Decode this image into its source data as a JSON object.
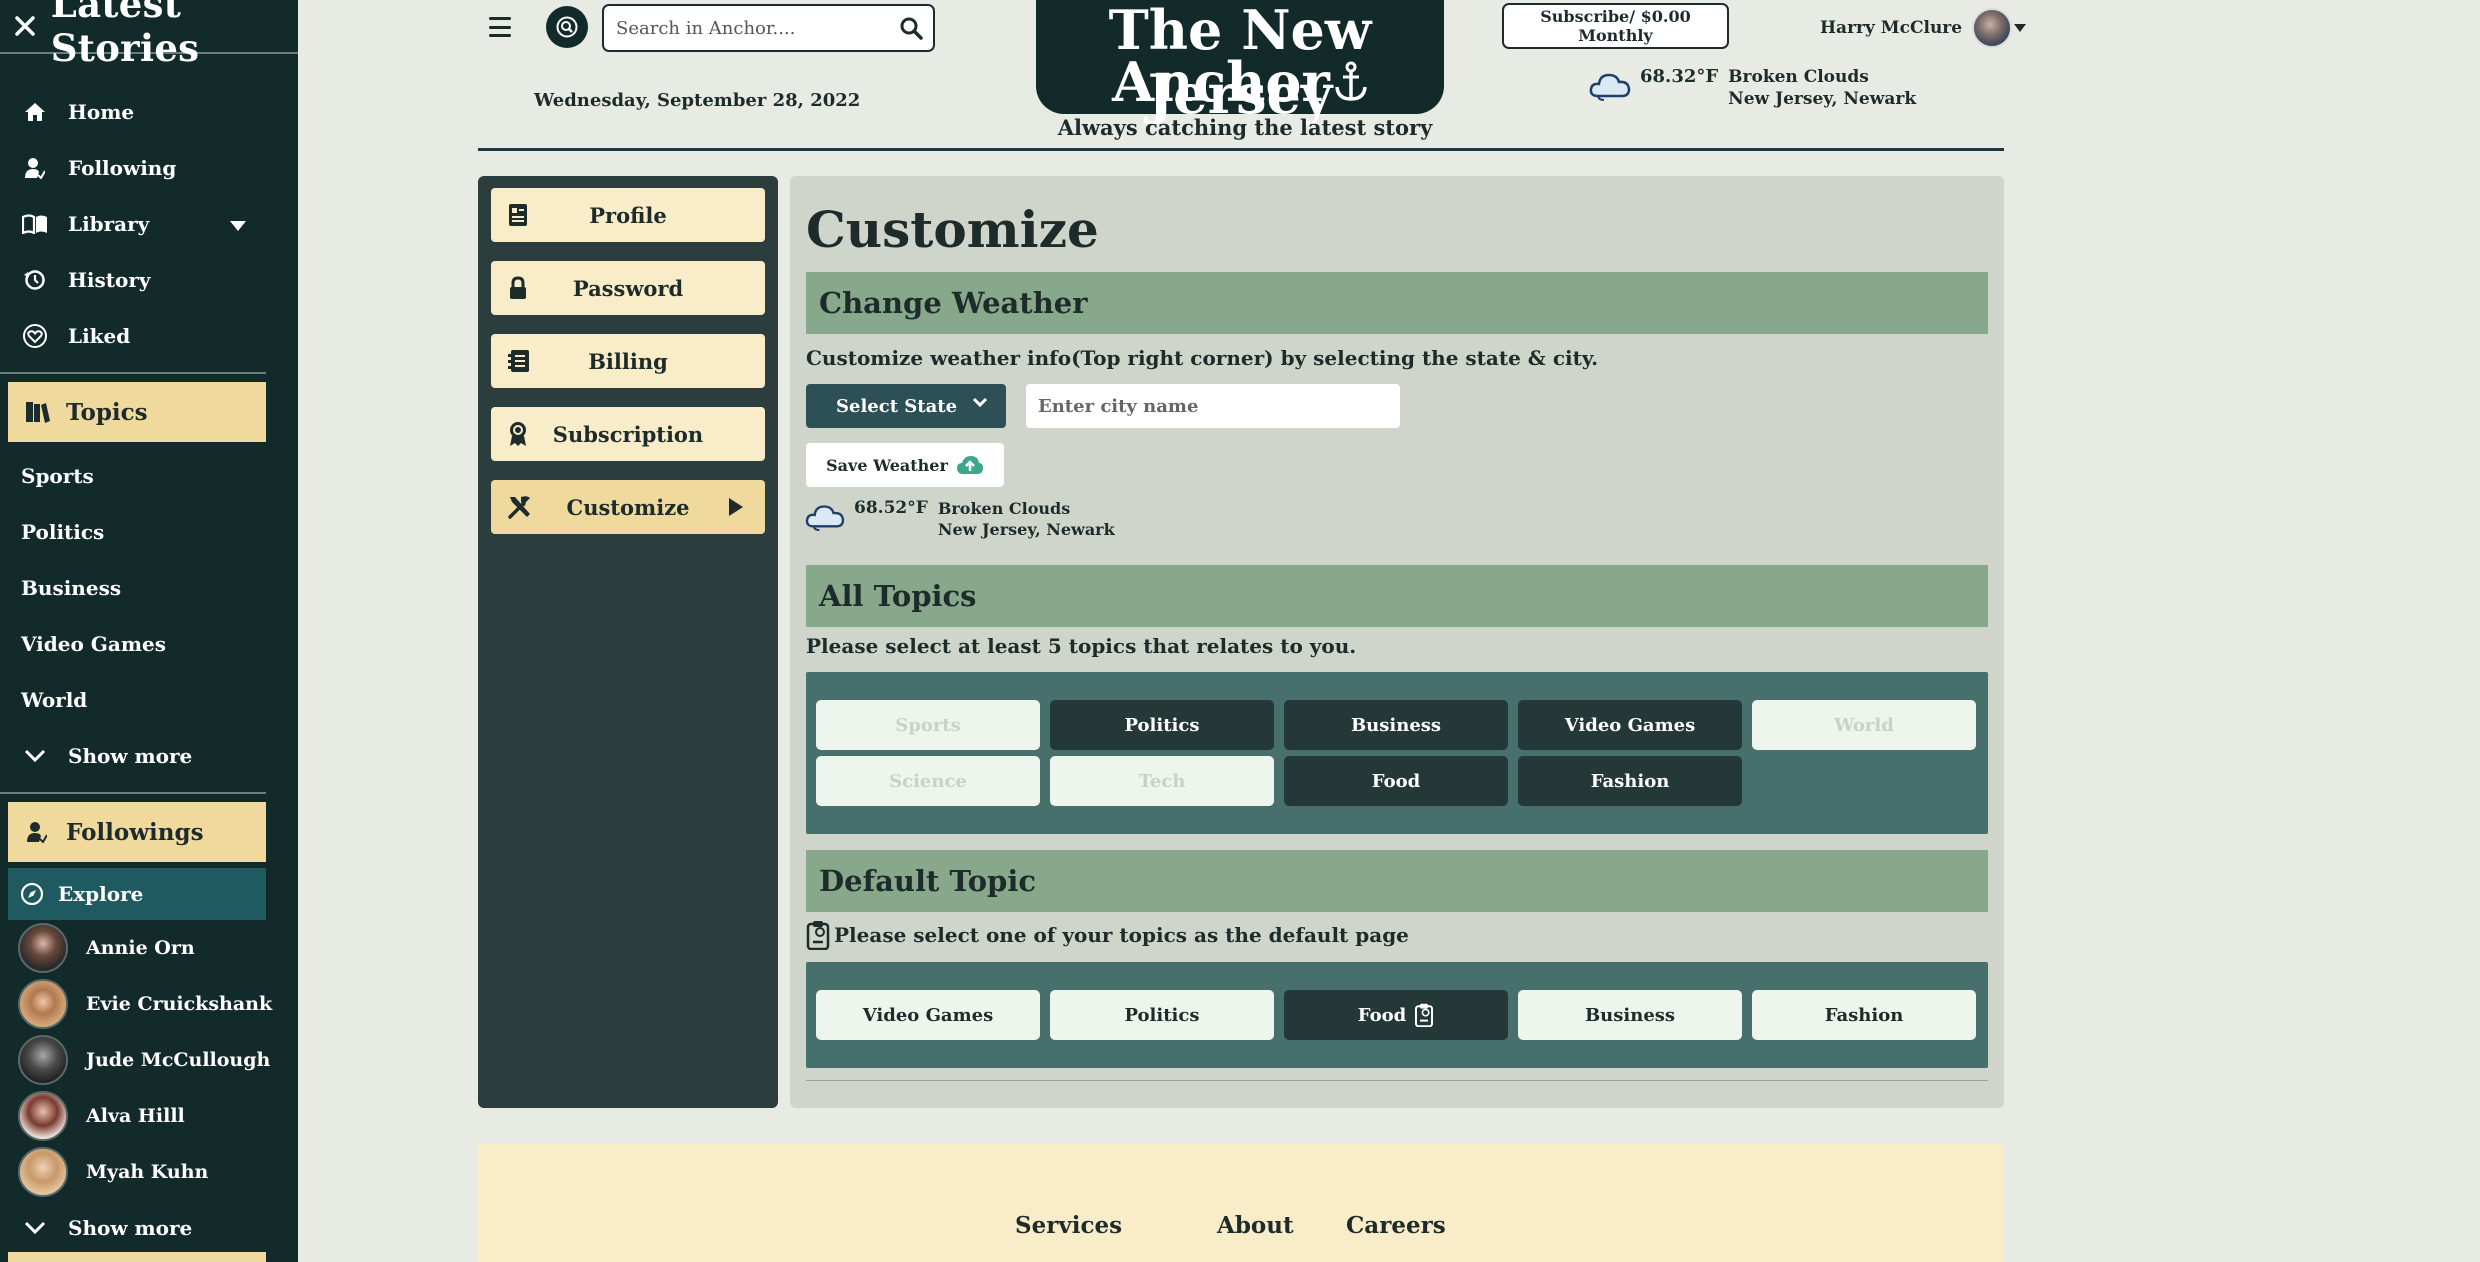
{
  "sidebar": {
    "title": "Latest Stories",
    "nav": [
      {
        "label": "Home",
        "icon": "home-icon"
      },
      {
        "label": "Following",
        "icon": "following-icon"
      },
      {
        "label": "Library",
        "icon": "library-icon"
      },
      {
        "label": "History",
        "icon": "history-icon"
      },
      {
        "label": "Liked",
        "icon": "heart-icon"
      }
    ],
    "topics_header": "Topics",
    "topics": [
      "Sports",
      "Politics",
      "Business",
      "Video Games",
      "World"
    ],
    "show_more": "Show more",
    "followings_header": "Followings",
    "explore": "Explore",
    "followings": [
      "Annie Orn",
      "Evie Cruickshank",
      "Jude McCullough",
      "Alva Hilll",
      "Myah Kuhn"
    ],
    "show_more_2": "Show more"
  },
  "header": {
    "search_placeholder": "Search in Anchor....",
    "date": "Wednesday, September 28, 2022",
    "masthead_line1": "The New Jersey",
    "masthead_line2": "Anchor",
    "tagline": "Always catching the latest story",
    "subscribe": "Subscribe/ $0.00 Monthly",
    "user_name": "Harry McClure",
    "weather": {
      "temp": "68.32°F",
      "condition": "Broken Clouds",
      "location": "New Jersey, Newark"
    }
  },
  "settings_nav": [
    {
      "label": "Profile",
      "icon": "profile-icon"
    },
    {
      "label": "Password",
      "icon": "lock-icon"
    },
    {
      "label": "Billing",
      "icon": "billing-icon"
    },
    {
      "label": "Subscription",
      "icon": "award-icon"
    },
    {
      "label": "Customize",
      "icon": "tools-icon",
      "active": true
    }
  ],
  "main": {
    "title": "Customize",
    "weather_section": {
      "title": "Change Weather",
      "description": "Customize weather info(Top right corner) by selecting the state & city.",
      "state_select": "Select State",
      "city_placeholder": "Enter city name",
      "save_label": "Save Weather",
      "temp": "68.52°F",
      "condition": "Broken Clouds",
      "location": "New Jersey, Newark"
    },
    "topics_section": {
      "title": "All Topics",
      "description": "Please select at least 5 topics that relates to you.",
      "topics": [
        {
          "label": "Sports",
          "selected": false
        },
        {
          "label": "Politics",
          "selected": true
        },
        {
          "label": "Business",
          "selected": true
        },
        {
          "label": "Video Games",
          "selected": true
        },
        {
          "label": "World",
          "selected": false
        },
        {
          "label": "Science",
          "selected": false
        },
        {
          "label": "Tech",
          "selected": false
        },
        {
          "label": "Food",
          "selected": true
        },
        {
          "label": "Fashion",
          "selected": true
        }
      ]
    },
    "default_section": {
      "title": "Default Topic",
      "description": "Please select one of your topics as the default page",
      "topics": [
        {
          "label": "Video Games",
          "selected": false
        },
        {
          "label": "Politics",
          "selected": false
        },
        {
          "label": "Food",
          "selected": true
        },
        {
          "label": "Business",
          "selected": false
        },
        {
          "label": "Fashion",
          "selected": false
        }
      ]
    }
  },
  "footer": {
    "links": [
      "Services",
      "About",
      "Careers"
    ]
  },
  "colors": {
    "sidebar": "#132a2b",
    "accent": "#f0d99d",
    "section": "#87a88a",
    "chip_area": "#476f6b",
    "panel": "#cfd5ca"
  }
}
